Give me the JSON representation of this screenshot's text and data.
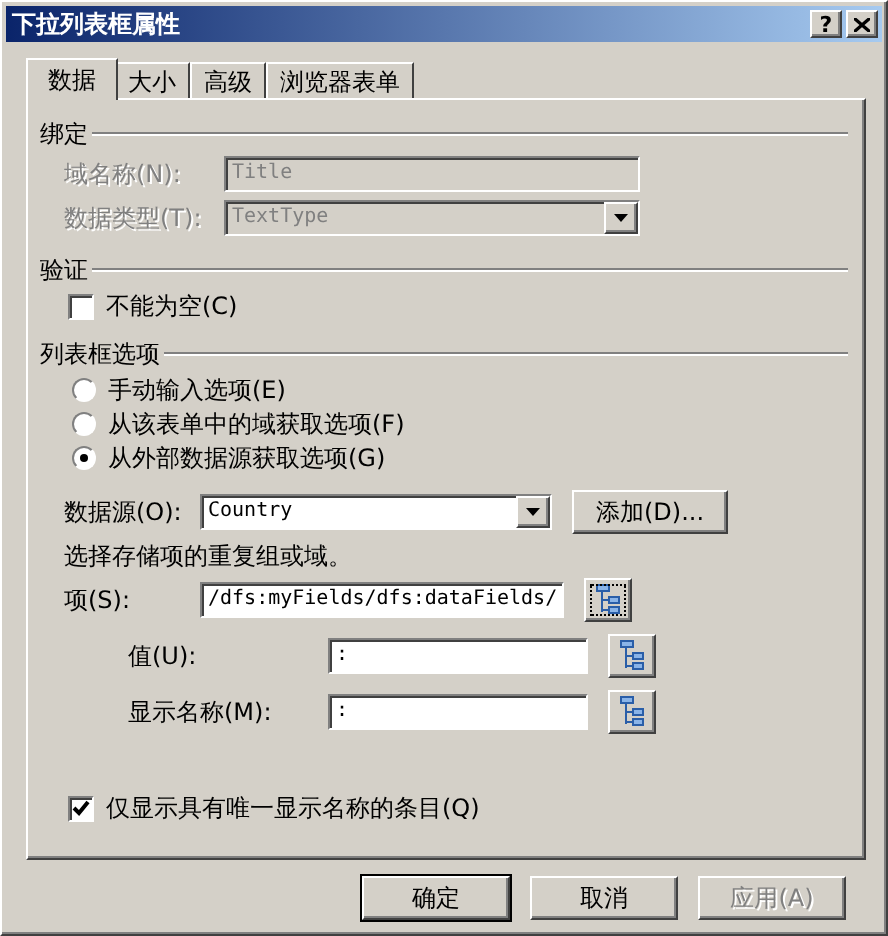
{
  "window": {
    "title": "下拉列表框属性",
    "help_button": "?"
  },
  "tabs": [
    {
      "label": "数据",
      "selected": true
    },
    {
      "label": "大小",
      "selected": false
    },
    {
      "label": "高级",
      "selected": false
    },
    {
      "label": "浏览器表单",
      "selected": false
    }
  ],
  "binding": {
    "heading": "绑定",
    "field_name": {
      "label": "域名称(N):",
      "value": "Title",
      "disabled": true
    },
    "data_type": {
      "label": "数据类型(T):",
      "value": "TextType",
      "disabled": true
    }
  },
  "validation": {
    "heading": "验证",
    "not_empty": {
      "label": "不能为空(C)",
      "checked": false
    }
  },
  "list_options": {
    "heading": "列表框选项",
    "radios": [
      {
        "label": "手动输入选项(E)",
        "selected": false
      },
      {
        "label": "从该表单中的域获取选项(F)",
        "selected": false
      },
      {
        "label": "从外部数据源获取选项(G)",
        "selected": true
      }
    ],
    "data_source": {
      "label": "数据源(O):",
      "value": "Country",
      "add_button": "添加(D)..."
    },
    "hint": "选择存储项的重复组或域。",
    "xpath_rows": [
      {
        "label": "项(S):",
        "value": "/dfs:myFields/dfs:dataFields/",
        "focused": true
      },
      {
        "label": "值(U):",
        "value": ":",
        "focused": false
      },
      {
        "label": "显示名称(M):",
        "value": ":",
        "focused": false
      }
    ],
    "unique_only": {
      "label": "仅显示具有唯一显示名称的条目(Q)",
      "checked": true
    }
  },
  "buttons": [
    {
      "label": "确定",
      "default": true,
      "disabled": false
    },
    {
      "label": "取消",
      "default": false,
      "disabled": false
    },
    {
      "label": "应用(A)",
      "default": false,
      "disabled": true
    }
  ]
}
